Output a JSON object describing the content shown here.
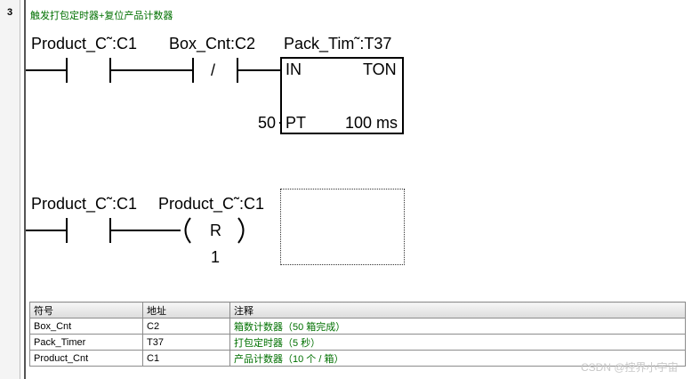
{
  "network": {
    "number": "3",
    "title": "触发打包定时器+复位产品计数器"
  },
  "rung1": {
    "contact1_label": "Product_C˜:C1",
    "contact2_label": "Box_Cnt:C2",
    "contact2_symbol": "/",
    "timer_label": "Pack_Tim˜:T37",
    "timer_in": "IN",
    "timer_type": "TON",
    "timer_pt": "PT",
    "timer_pt_value": "50",
    "timer_base": "100 ms"
  },
  "rung2": {
    "contact1_label": "Product_C˜:C1",
    "coil_label": "Product_C˜:C1",
    "coil_symbol": "R",
    "coil_count": "1"
  },
  "symbol_table": {
    "headers": [
      "符号",
      "地址",
      "注释"
    ],
    "rows": [
      [
        "Box_Cnt",
        "C2",
        "箱数计数器（50 箱完成）"
      ],
      [
        "Pack_Timer",
        "T37",
        "打包定时器（5 秒）"
      ],
      [
        "Product_Cnt",
        "C1",
        "产品计数器（10 个 / 箱）"
      ]
    ]
  },
  "watermark": "CSDN @控界小宇宙",
  "colors": {
    "comment_green": "#007000",
    "value_olive": "#8a8a00"
  }
}
